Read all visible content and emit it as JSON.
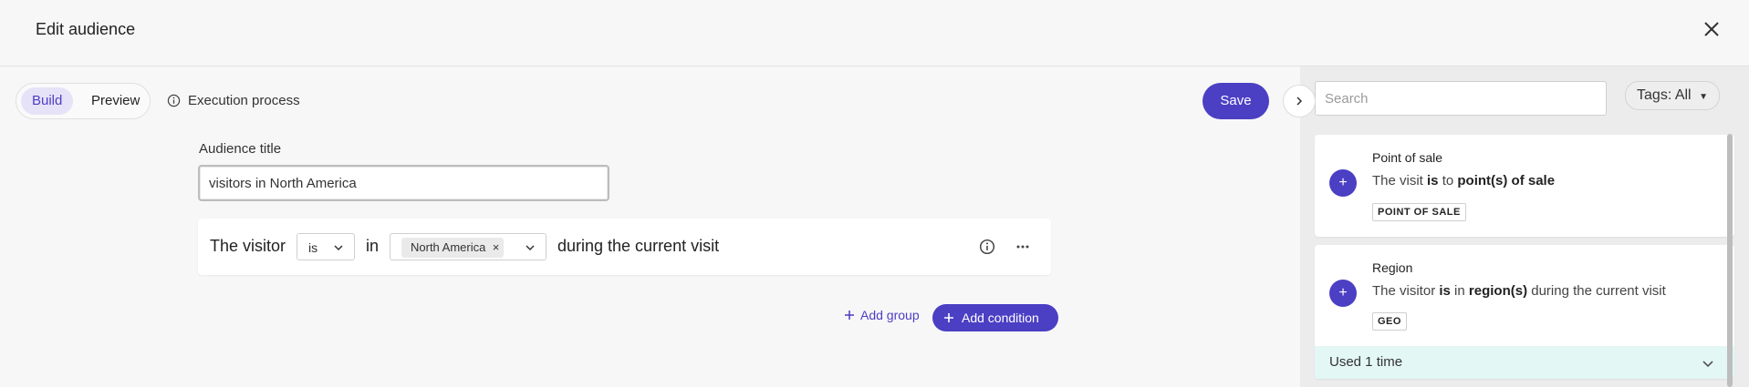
{
  "header": {
    "title": "Edit audience"
  },
  "toolbar": {
    "build_label": "Build",
    "preview_label": "Preview",
    "execution_label": "Execution process",
    "save_label": "Save"
  },
  "form": {
    "title_label": "Audience title",
    "title_value": "visitors in North America"
  },
  "condition": {
    "prefix": "The visitor",
    "operator": "is",
    "connector": "in",
    "tag": "North America",
    "tag_remove": "×",
    "suffix": "during the current visit"
  },
  "actions": {
    "add_group": "Add group",
    "add_condition": "Add condition"
  },
  "sidebar": {
    "search_placeholder": "Search",
    "tags_label": "Tags: All",
    "cards": [
      {
        "title": "Point of sale",
        "desc_pre": "The visit ",
        "desc_bold1": "is",
        "desc_mid": " to ",
        "desc_bold2": "point(s) of sale",
        "desc_post": "",
        "badge": "POINT OF SALE"
      },
      {
        "title": "Region",
        "desc_pre": "The visitor ",
        "desc_bold1": "is",
        "desc_mid": " in ",
        "desc_bold2": "region(s)",
        "desc_post": " during the current visit",
        "badge": "GEO",
        "used": "Used 1 time"
      }
    ]
  },
  "colors": {
    "accent": "#4b3fc4",
    "used_bg": "#e3f7f5"
  }
}
